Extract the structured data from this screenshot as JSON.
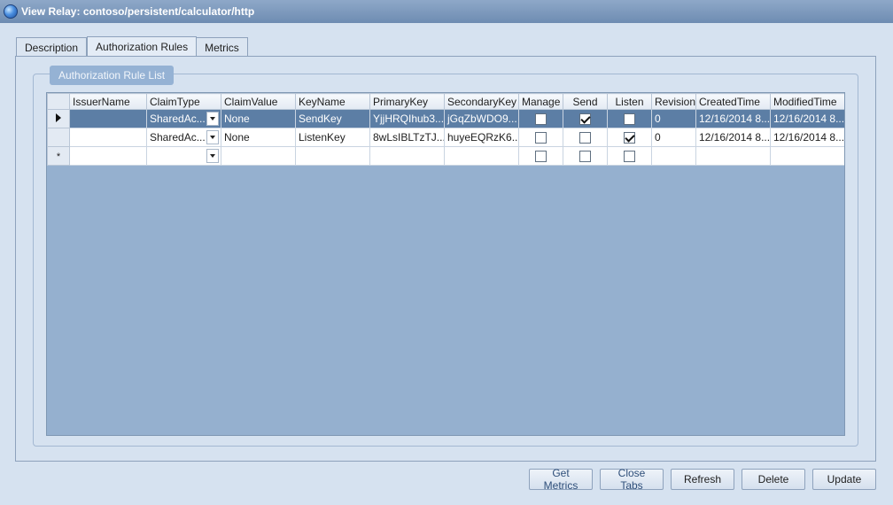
{
  "window": {
    "title": "View Relay: contoso/persistent/calculator/http",
    "icon": "globe-icon"
  },
  "tabs": [
    {
      "label": "Description",
      "active": false
    },
    {
      "label": "Authorization Rules",
      "active": true
    },
    {
      "label": "Metrics",
      "active": false
    }
  ],
  "group": {
    "label": "Authorization Rule List"
  },
  "grid": {
    "columns": [
      "IssuerName",
      "ClaimType",
      "ClaimValue",
      "KeyName",
      "PrimaryKey",
      "SecondaryKey",
      "Manage",
      "Send",
      "Listen",
      "Revision",
      "CreatedTime",
      "ModifiedTime"
    ],
    "rows": [
      {
        "selected": true,
        "issuer": "",
        "claim_type": "SharedAc...",
        "claim_value": "None",
        "key_name": "SendKey",
        "primary_key": "YjjHRQIhub3...",
        "secondary_key": "jGqZbWDO9...",
        "manage": false,
        "send": true,
        "listen": false,
        "revision": "0",
        "created": "12/16/2014 8...",
        "modified": "12/16/2014 8..."
      },
      {
        "selected": false,
        "issuer": "",
        "claim_type": "SharedAc...",
        "claim_value": "None",
        "key_name": "ListenKey",
        "primary_key": "8wLsIBLTzTJ...",
        "secondary_key": "huyeEQRzK6...",
        "manage": false,
        "send": false,
        "listen": true,
        "revision": "0",
        "created": "12/16/2014 8...",
        "modified": "12/16/2014 8..."
      }
    ],
    "new_row_marker": "*"
  },
  "buttons": {
    "get_metrics": "Get Metrics",
    "close_tabs": "Close Tabs",
    "refresh": "Refresh",
    "delete": "Delete",
    "update": "Update"
  },
  "colors": {
    "title_bar": "#7b97bc",
    "selected_row": "#5c7ea5",
    "grid_background": "#95b0cf",
    "group_label": "#95b2d4"
  }
}
